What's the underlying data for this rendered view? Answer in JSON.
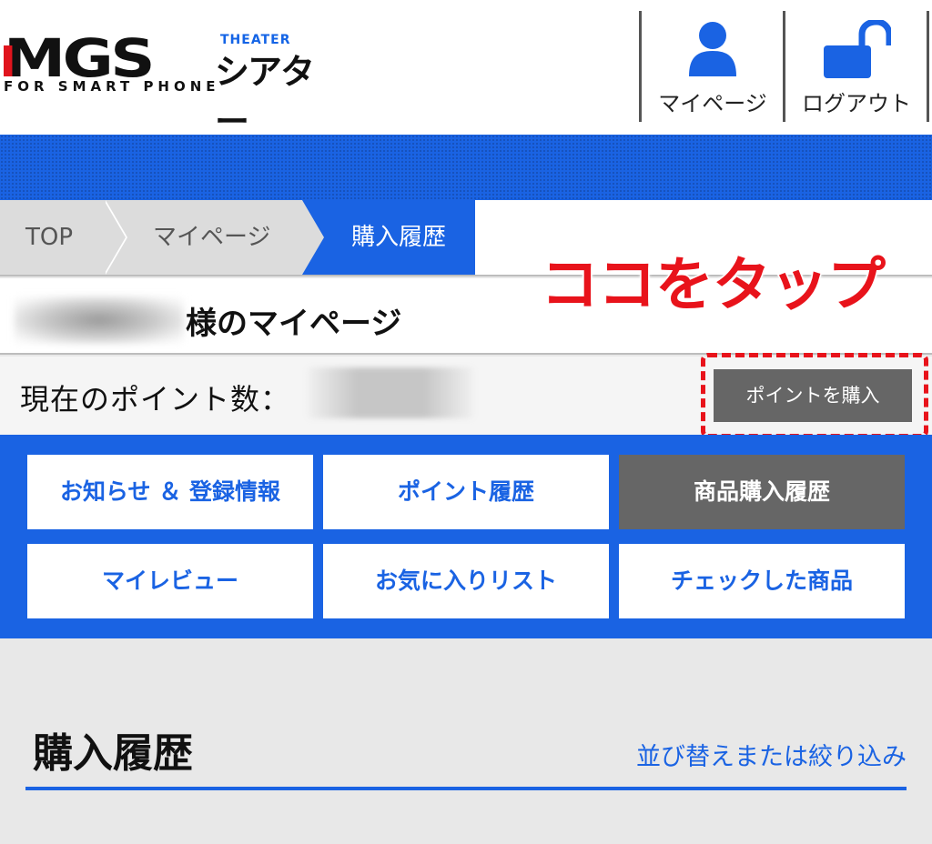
{
  "header": {
    "logo": {
      "brand": "MGS",
      "theater_en": "THEATER",
      "theater_ja": "シアター",
      "tagline": "FOR SMART PHONE"
    },
    "mypage_label": "マイページ",
    "logout_label": "ログアウト"
  },
  "breadcrumb": {
    "top": "TOP",
    "mypage": "マイページ",
    "current": "購入履歴"
  },
  "greeting": {
    "suffix": "様のマイページ"
  },
  "annotation": "ココをタップ",
  "points": {
    "label": "現在のポイント数：",
    "buy_button": "ポイントを購入"
  },
  "menu": {
    "items": [
      {
        "label": "お知らせ ＆ 登録情報",
        "active": false
      },
      {
        "label": "ポイント履歴",
        "active": false
      },
      {
        "label": "商品購入履歴",
        "active": true
      },
      {
        "label": "マイレビュー",
        "active": false
      },
      {
        "label": "お気に入りリスト",
        "active": false
      },
      {
        "label": "チェックした商品",
        "active": false
      }
    ]
  },
  "section": {
    "title": "購入履歴",
    "sort_link": "並び替えまたは絞り込み"
  },
  "colors": {
    "brand_blue": "#1a63e3",
    "accent_red": "#e8131b",
    "active_gray": "#666666"
  }
}
